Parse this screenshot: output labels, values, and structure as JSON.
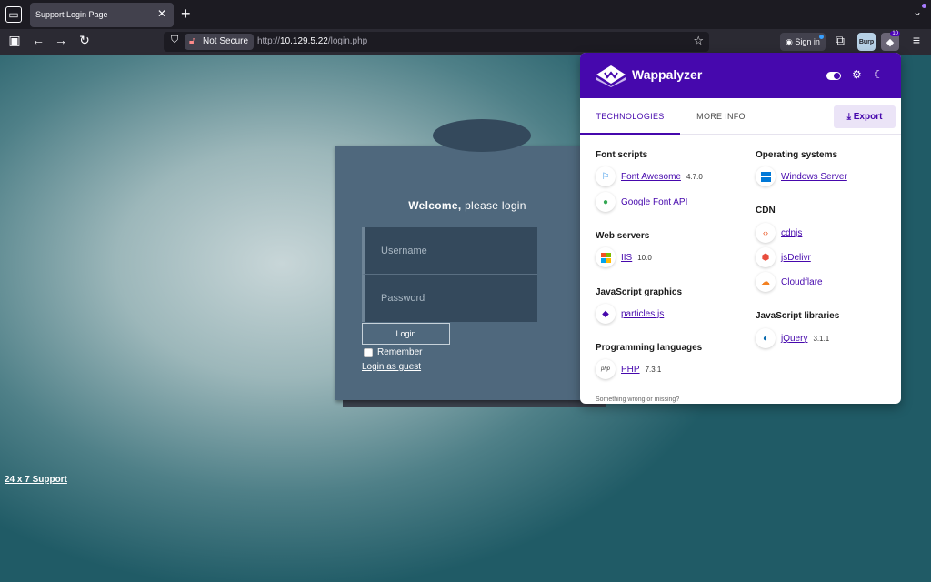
{
  "browser": {
    "tab_title": "Support Login Page",
    "tab_close": "✕",
    "new_tab": "+",
    "not_secure": "Not Secure",
    "url_prefix": "http://",
    "url_host": "10.129.5.22",
    "url_path": "/login.php",
    "sign_in": "Sign in",
    "burp_label": "Burp",
    "ext_badge": "10"
  },
  "page": {
    "welcome_bold": "Welcome,",
    "welcome_rest": " please login",
    "username_placeholder": "Username",
    "password_placeholder": "Password",
    "login_button": "Login",
    "remember_label": "Remember",
    "guest_link": "Login as guest",
    "support_link": "24 x 7 Support"
  },
  "wappalyzer": {
    "title": "Wappalyzer",
    "tab_technologies": "TECHNOLOGIES",
    "tab_more_info": "MORE INFO",
    "export_label": "Export",
    "footer": "Something wrong or missing?",
    "categories": {
      "font_scripts": "Font scripts",
      "web_servers": "Web servers",
      "js_graphics": "JavaScript graphics",
      "prog_languages": "Programming languages",
      "os": "Operating systems",
      "cdn": "CDN",
      "js_libraries": "JavaScript libraries"
    },
    "techs": {
      "font_awesome": {
        "name": "Font Awesome",
        "version": "4.7.0"
      },
      "google_font_api": {
        "name": "Google Font API",
        "version": ""
      },
      "iis": {
        "name": "IIS",
        "version": "10.0"
      },
      "particles": {
        "name": "particles.js",
        "version": ""
      },
      "php": {
        "name": "PHP",
        "version": "7.3.1",
        "icon_text": "php"
      },
      "windows_server": {
        "name": "Windows Server",
        "version": ""
      },
      "cdnjs": {
        "name": "cdnjs",
        "version": ""
      },
      "jsdelivr": {
        "name": "jsDelivr",
        "version": ""
      },
      "cloudflare": {
        "name": "Cloudflare",
        "version": ""
      },
      "jquery": {
        "name": "jQuery",
        "version": "3.1.1"
      }
    }
  },
  "colors": {
    "wappalyzer_purple": "#4608ad",
    "login_panel": "#4f687d",
    "browser_dark": "#1c1b22"
  }
}
